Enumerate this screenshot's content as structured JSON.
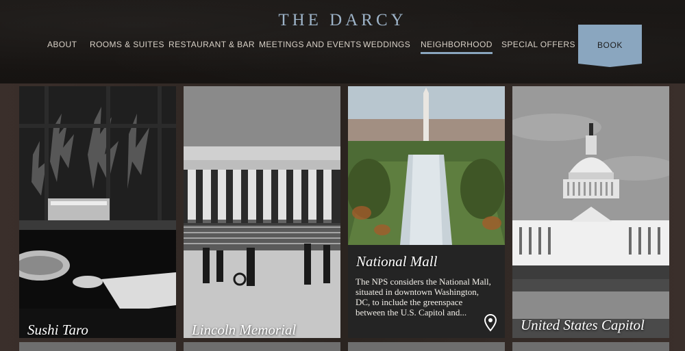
{
  "brand": {
    "name": "THE DARCY"
  },
  "nav": {
    "items": [
      {
        "label": "ABOUT"
      },
      {
        "label": "ROOMS & SUITES"
      },
      {
        "label": "RESTAURANT & BAR"
      },
      {
        "label": "MEETINGS AND EVENTS"
      },
      {
        "label": "WEDDINGS"
      },
      {
        "label": "NEIGHBORHOOD"
      },
      {
        "label": "SPECIAL OFFERS"
      }
    ],
    "active": "NEIGHBORHOOD",
    "book_label": "BOOK"
  },
  "cards": [
    {
      "title": "Sushi Taro",
      "icon": "photo"
    },
    {
      "title": "Lincoln Memorial",
      "icon": "photo"
    },
    {
      "title": "National Mall",
      "description": "The NPS considers the National Mall, situated in downtown Washington, DC, to include the greenspace between the U.S. Capitol and...",
      "icon": "map-pin-icon"
    },
    {
      "title": "United States Capitol",
      "icon": "photo"
    }
  ],
  "colors": {
    "accent": "#8aa6bf",
    "logo": "#9db3c8",
    "header_bg": "#1b1816"
  }
}
